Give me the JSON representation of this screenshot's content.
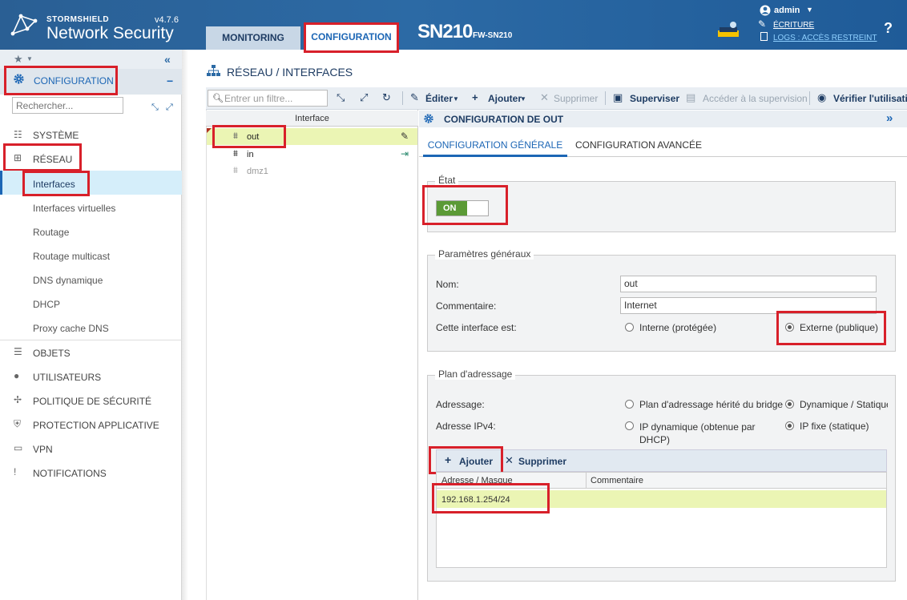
{
  "header": {
    "brand_small": "STORMSHIELD",
    "brand_version": "v4.7.6",
    "brand_big": "Network Security",
    "tabs": [
      "MONITORING",
      "CONFIGURATION"
    ],
    "model": "SN210",
    "serial": "FW-SN210",
    "user": "admin",
    "write_mode": "ÉCRITURE",
    "logs": "LOGS : ACCÈS RESTREINT",
    "help": "?"
  },
  "sidebar": {
    "section_title": "CONFIGURATION",
    "search_placeholder": "Rechercher...",
    "top_items": [
      "SYSTÈME",
      "RÉSEAU"
    ],
    "sub_items": [
      "Interfaces",
      "Interfaces virtuelles",
      "Routage",
      "Routage multicast",
      "DNS dynamique",
      "DHCP",
      "Proxy cache DNS"
    ],
    "bottom_items": [
      "OBJETS",
      "UTILISATEURS",
      "POLITIQUE DE SÉCURITÉ",
      "PROTECTION APPLICATIVE",
      "VPN",
      "NOTIFICATIONS"
    ]
  },
  "main": {
    "breadcrumb": "RÉSEAU / INTERFACES",
    "toolbar": {
      "filter_placeholder": "Entrer un filtre...",
      "edit": "Éditer",
      "add": "Ajouter",
      "delete": "Supprimer",
      "supervise": "Superviser",
      "access_supervision": "Accéder à la supervision",
      "check_usage": "Vérifier l'utilisation"
    },
    "list": {
      "header": "Interface",
      "rows": [
        "out",
        "in",
        "dmz1"
      ]
    },
    "detail": {
      "title": "CONFIGURATION DE OUT",
      "tabs": [
        "CONFIGURATION GÉNÉRALE",
        "CONFIGURATION AVANCÉE"
      ],
      "state_legend": "État",
      "toggle": "ON",
      "general_legend": "Paramètres généraux",
      "name_label": "Nom:",
      "name_value": "out",
      "comment_label": "Commentaire:",
      "comment_value": "Internet",
      "iface_type_label": "Cette interface est:",
      "internal": "Interne (protégée)",
      "external": "Externe (publique)",
      "addr_legend": "Plan d'adressage",
      "addressing_label": "Adressage:",
      "addr_opt1": "Plan d'adressage hérité du bridge",
      "addr_opt2": "Dynamique / Statique",
      "ipv4_label": "Adresse IPv4:",
      "ipv4_opt1": "IP dynamique (obtenue par DHCP)",
      "ipv4_opt2": "IP fixe (statique)",
      "grid_add": "Ajouter",
      "grid_delete": "Supprimer",
      "grid_col1": "Adresse / Masque",
      "grid_col2": "Commentaire",
      "grid_value": "192.168.1.254/24"
    }
  }
}
